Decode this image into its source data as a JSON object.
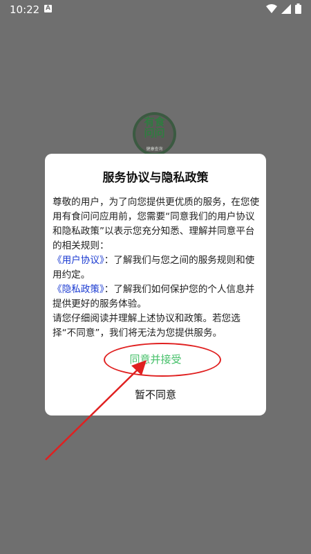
{
  "status_bar": {
    "time": "10:22",
    "notification_icon": "A",
    "icons": [
      "wifi-icon",
      "signal-icon",
      "battery-icon"
    ]
  },
  "logo": {
    "line1": "有食",
    "line2": "问问",
    "subtitle": "健康查询"
  },
  "dialog": {
    "title": "服务协议与隐私政策",
    "intro": "尊敬的用户，为了向您提供更优质的服务，在您使用有食问问应用前，您需要“同意我们的用户协议和隐私政策”以表示您充分知悉、理解并同意平台的相关规则：",
    "user_agreement_link": "《用户协议》",
    "user_agreement_desc": "：了解我们与您之间的服务规则和使用约定。",
    "privacy_link": "《隐私政策》",
    "privacy_desc": "：了解我们如何保护您的个人信息并提供更好的服务体验。",
    "closing": "请您仔细阅读并理解上述协议和政策。若您选择“不同意”，我们将无法为您提供服务。",
    "agree_button": "同意并接受",
    "disagree_button": "暂不同意"
  },
  "colors": {
    "overlay": "#6f6f6f",
    "link": "#1a3ad1",
    "agree": "#46c06a",
    "annotation": "#e02020"
  }
}
